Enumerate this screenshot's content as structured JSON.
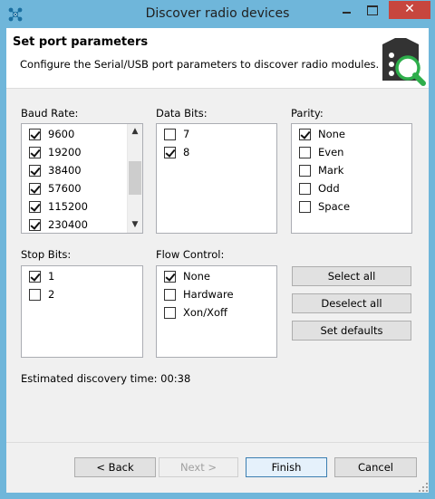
{
  "window": {
    "title": "Discover radio devices",
    "close_glyph": "✕"
  },
  "header": {
    "title": "Set port parameters",
    "description": "Configure the Serial/USB port parameters to discover radio modules."
  },
  "baud_rate": {
    "label": "Baud Rate:",
    "items": [
      {
        "label": "9600",
        "checked": true
      },
      {
        "label": "19200",
        "checked": true
      },
      {
        "label": "38400",
        "checked": true
      },
      {
        "label": "57600",
        "checked": true
      },
      {
        "label": "115200",
        "checked": true
      },
      {
        "label": "230400",
        "checked": true
      }
    ]
  },
  "data_bits": {
    "label": "Data Bits:",
    "items": [
      {
        "label": "7",
        "checked": false
      },
      {
        "label": "8",
        "checked": true
      }
    ]
  },
  "parity": {
    "label": "Parity:",
    "items": [
      {
        "label": "None",
        "checked": true
      },
      {
        "label": "Even",
        "checked": false
      },
      {
        "label": "Mark",
        "checked": false
      },
      {
        "label": "Odd",
        "checked": false
      },
      {
        "label": "Space",
        "checked": false
      }
    ]
  },
  "stop_bits": {
    "label": "Stop Bits:",
    "items": [
      {
        "label": "1",
        "checked": true
      },
      {
        "label": "2",
        "checked": false
      }
    ]
  },
  "flow_control": {
    "label": "Flow Control:",
    "items": [
      {
        "label": "None",
        "checked": true
      },
      {
        "label": "Hardware",
        "checked": false
      },
      {
        "label": "Xon/Xoff",
        "checked": false
      }
    ]
  },
  "actions": {
    "select_all": "Select all",
    "deselect_all": "Deselect all",
    "set_defaults": "Set defaults"
  },
  "status": {
    "estimated_time": "Estimated discovery time: 00:38"
  },
  "footer": {
    "back": "< Back",
    "next": "Next >",
    "finish": "Finish",
    "cancel": "Cancel"
  },
  "colors": {
    "titlebar": "#6fb6da",
    "close": "#c7463e",
    "icon_green": "#2eae4b",
    "icon_dark": "#333333"
  },
  "icons": {
    "app": "network-nodes-icon",
    "header": "radio-module-search-icon"
  }
}
